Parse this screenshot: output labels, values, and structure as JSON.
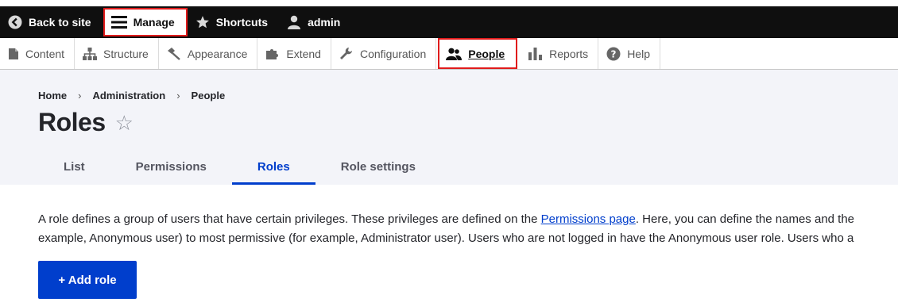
{
  "toolbar": {
    "back_label": "Back to site",
    "manage_label": "Manage",
    "shortcuts_label": "Shortcuts",
    "user_label": "admin"
  },
  "tray": {
    "items": [
      {
        "label": "Content",
        "icon": "content-icon"
      },
      {
        "label": "Structure",
        "icon": "structure-icon"
      },
      {
        "label": "Appearance",
        "icon": "appearance-icon"
      },
      {
        "label": "Extend",
        "icon": "extend-icon"
      },
      {
        "label": "Configuration",
        "icon": "wrench-icon"
      },
      {
        "label": "People",
        "icon": "people-icon",
        "active": true
      },
      {
        "label": "Reports",
        "icon": "reports-icon"
      },
      {
        "label": "Help",
        "icon": "help-icon"
      }
    ]
  },
  "breadcrumb": {
    "items": [
      "Home",
      "Administration",
      "People"
    ],
    "separator": "›"
  },
  "page": {
    "title": "Roles",
    "favorite_symbol": "☆"
  },
  "tabs": [
    {
      "label": "List"
    },
    {
      "label": "Permissions"
    },
    {
      "label": "Roles",
      "active": true
    },
    {
      "label": "Role settings"
    }
  ],
  "description": {
    "line1_before": "A role defines a group of users that have certain privileges. These privileges are defined on the ",
    "line1_link": "Permissions page",
    "line1_after": ". Here, you can define the names and the",
    "line2": "example, Anonymous user) to most permissive (for example, Administrator user). Users who are not logged in have the Anonymous user role. Users who a"
  },
  "actions": {
    "add_role_label": "+ Add role"
  },
  "colors": {
    "accent": "#003ecc",
    "toolbar_bg": "#0f0f0f",
    "highlight": "#e01b1b",
    "header_bg": "#f3f4f9"
  }
}
